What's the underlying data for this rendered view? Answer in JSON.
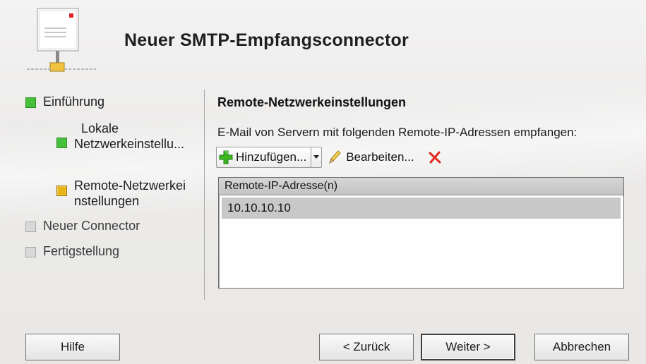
{
  "header": {
    "title": "Neuer SMTP-Empfangsconnector"
  },
  "steps": [
    {
      "line1": "Einführung",
      "line2": ""
    },
    {
      "line1": "Lokale",
      "line2": "Netzwerkeinstellu..."
    },
    {
      "line1": "Remote-Netzwerkei",
      "line2": "nstellungen"
    },
    {
      "line1": "Neuer Connector",
      "line2": ""
    },
    {
      "line1": "Fertigstellung",
      "line2": ""
    }
  ],
  "content": {
    "section_title": "Remote-Netzwerkeinstellungen",
    "description": "E-Mail von Servern mit folgenden Remote-IP-Adressen empfangen:",
    "toolbar": {
      "add_label": "Hinzufügen...",
      "edit_label": "Bearbeiten..."
    },
    "list": {
      "header": "Remote-IP-Adresse(n)",
      "rows": [
        "10.10.10.10"
      ]
    }
  },
  "buttons": {
    "help": "Hilfe",
    "back": "< Zurück",
    "next": "Weiter >",
    "cancel": "Abbrechen"
  },
  "icons": {
    "add": "green-plus-icon",
    "dropdown": "chevron-down-icon",
    "edit": "pencil-icon",
    "delete": "red-x-icon",
    "header": "mail-network-icon"
  },
  "colors": {
    "step_done": "#46c03a",
    "step_current": "#e6b416",
    "step_pending": "#d9d9d9",
    "delete": "#e02a1f",
    "add": "#3cb521"
  }
}
